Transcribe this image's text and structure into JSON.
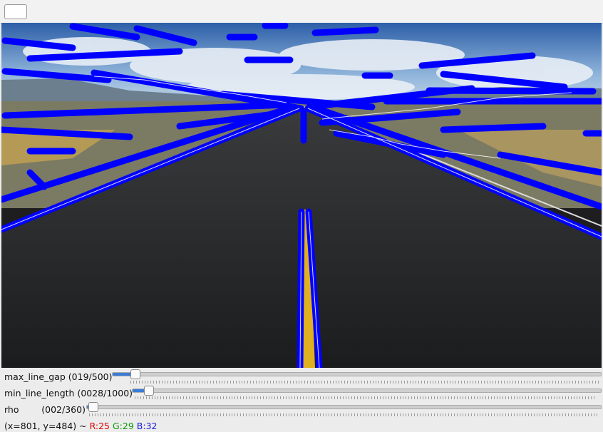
{
  "window": {
    "toolbar_button_icon": "blank-button-icon"
  },
  "image": {
    "description_icon": "road-image-with-hough-lines"
  },
  "trackbars": [
    {
      "label": "max_line_gap (019/500)",
      "value": 19,
      "max": 500
    },
    {
      "label": "min_line_length (0028/1000)",
      "value": 28,
      "max": 1000
    },
    {
      "label": "rho        (002/360)",
      "value": 2,
      "max": 360
    }
  ],
  "status": {
    "coords": "(x=801, y=484) ~ ",
    "r": "R:25",
    "g": "G:29",
    "b": "B:32"
  },
  "colors": {
    "line_overlay": "#0000ff",
    "accent": "#3a7bd5"
  }
}
